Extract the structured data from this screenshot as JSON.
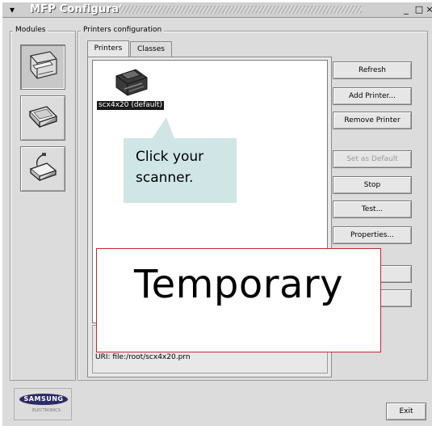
{
  "window": {
    "title": "MFP Configurator",
    "controls": {
      "menu": "▾",
      "minimize": "_",
      "maximize": "□",
      "close": "×"
    }
  },
  "modules": {
    "label": "Modules",
    "items": [
      {
        "name": "Printers",
        "icon": "printer-module-icon",
        "active": true
      },
      {
        "name": "Scanners",
        "icon": "scanner-module-icon",
        "active": false
      },
      {
        "name": "Ports",
        "icon": "port-module-icon",
        "active": false
      }
    ]
  },
  "printers_config": {
    "label": "Printers configuration",
    "tabs": [
      {
        "label": "Printers",
        "active": true
      },
      {
        "label": "Classes",
        "active": false
      }
    ],
    "printers": [
      {
        "label": "scx4x20 (default)",
        "selected": true
      }
    ],
    "info": {
      "uri": "URI: file:/root/scx4x20.prn"
    },
    "buttons": [
      {
        "label": "Refresh",
        "enabled": true
      },
      {
        "label": "Add Printer...",
        "enabled": true
      },
      {
        "label": "Remove Printer",
        "enabled": true
      },
      {
        "label": "Set as Default",
        "enabled": false
      },
      {
        "label": "Stop",
        "enabled": true
      },
      {
        "label": "Test...",
        "enabled": true
      },
      {
        "label": "Properties...",
        "enabled": true
      }
    ]
  },
  "callout": {
    "line1": "Click your",
    "line2": "scanner."
  },
  "overlay": {
    "text": "Temporary"
  },
  "brand": {
    "logo": "SAMSUNG",
    "sub": "ELECTRONICS"
  },
  "footer": {
    "exit_label": "Exit"
  },
  "colors": {
    "callout_bg": "#cfe5e6",
    "overlay_border": "#c8272a"
  }
}
